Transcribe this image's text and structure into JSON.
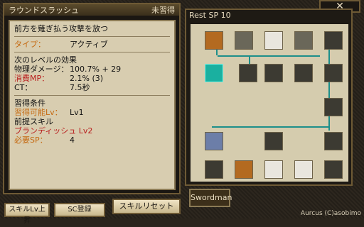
{
  "left": {
    "skill_name": "ラウンドスラッシュ",
    "status": "未習得",
    "description": "前方を薙ぎ払う攻撃を放つ",
    "type_label": "タイプ：",
    "type_value": "アクティブ",
    "next_level_title": "次のレベルの効果",
    "physical_label": "物理ダメージ：",
    "physical_value": "100.7% + 29",
    "mp_label": "消費MP：",
    "mp_value": "2.1% (3)",
    "ct_label": "CT：",
    "ct_value": "7.5秒",
    "learn_title": "習得条件",
    "learn_lv_label": "習得可能Lv：",
    "learn_lv_value": "Lv1",
    "prereq_title": "前提スキル",
    "prereq_value": "ブランディッシュ Lv2",
    "need_sp_label": "必要SP：",
    "need_sp_value": "4"
  },
  "right": {
    "rest_sp": "Rest SP 10",
    "tab": "Swordman"
  },
  "buttons": {
    "skill_lv_up": "スキルLv上昇",
    "sc_register": "SC登録",
    "skill_reset": "スキルリセット"
  },
  "close": "✕",
  "copyright": "Aurcus (C)asobimo"
}
